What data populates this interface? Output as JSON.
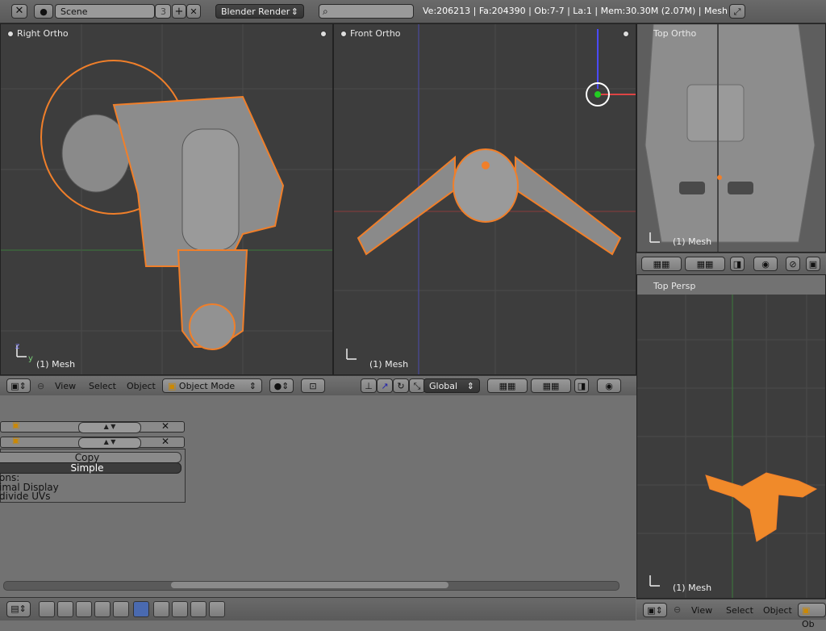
{
  "topbar": {
    "scene_name": "Scene",
    "scene_users": "3",
    "renderer": "Blender Render",
    "search_placeholder": "",
    "stats": "Ve:206213 | Fa:204390 | Ob:7-7 | La:1 | Mem:30.30M (2.07M) | Mesh"
  },
  "viewports": {
    "right_ortho": {
      "title": "Right Ortho",
      "object": "(1) Mesh"
    },
    "front_ortho": {
      "title": "Front Ortho",
      "object": "(1) Mesh"
    },
    "top_ortho": {
      "title": "Top Ortho",
      "object": "(1) Mesh"
    },
    "top_persp": {
      "title": "Top Persp",
      "object": "(1) Mesh"
    }
  },
  "header3d": {
    "view": "View",
    "select": "Select",
    "object": "Object",
    "mode": "Object Mode",
    "orientation": "Global"
  },
  "header_right": {
    "view": "View",
    "select": "Select",
    "object": "Object",
    "mode_partial": "Ob"
  },
  "modifiers": {
    "copy": "Copy",
    "simple": "Simple",
    "options_label": "ons:",
    "optimal": "imal Display",
    "subdivide": "divide UVs"
  },
  "axes": {
    "y": "y",
    "z": "z"
  },
  "colors": {
    "viewport_bg": "#3d3d3d",
    "selection": "#f07f2a",
    "header_bg": "#727272"
  }
}
